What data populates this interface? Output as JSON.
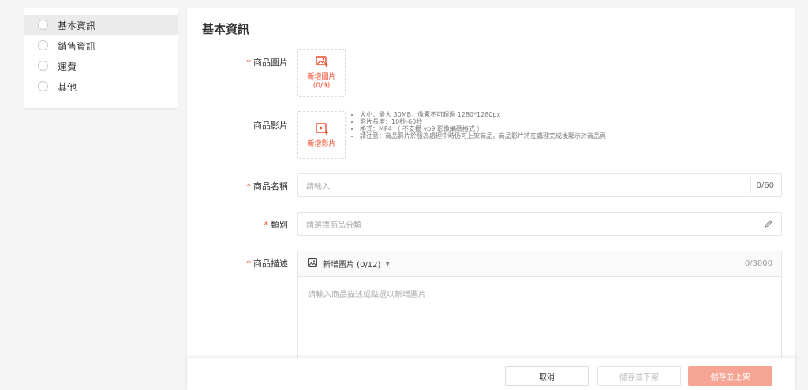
{
  "sidebar": {
    "items": [
      {
        "label": "基本資訊"
      },
      {
        "label": "銷售資訊"
      },
      {
        "label": "運費"
      },
      {
        "label": "其他"
      }
    ]
  },
  "main": {
    "title": "基本資訊",
    "product_images": {
      "label": "商品圖片",
      "button_text": "新增圖片",
      "count": "(0/9)"
    },
    "product_video": {
      "label": "商品影片",
      "button_text": "新增影片",
      "hints": [
        "大小：最大 30MB，像素不可超過 1280*1280px",
        "影片長度：10秒-60秒",
        "格式：MP4 （ 不支援 vp9 影像編碼格式 ）",
        "請注意：商品影片於服為處理中時仍可上架商品，商品影片將在處理完成後顯示於商品頁"
      ]
    },
    "product_name": {
      "label": "商品名稱",
      "placeholder": "請輸入",
      "counter": "0/60"
    },
    "category": {
      "label": "類別",
      "placeholder": "請選擇商品分類"
    },
    "description": {
      "label": "商品描述",
      "toolbar_label": "新增圖片 (0/12)",
      "counter": "0/3000",
      "placeholder": "請輸入商品描述或點選以新增圖片"
    }
  },
  "footer": {
    "cancel_label": "取消",
    "save_delist_label": "儲存並下架",
    "save_publish_label": "儲存並上架"
  },
  "colors": {
    "accent": "#ee4d2d",
    "publish_button": "#f6a493"
  },
  "icons": {
    "image_add": "image-add-icon",
    "video_add": "video-add-icon",
    "pencil": "pencil-icon",
    "picture": "picture-icon"
  }
}
